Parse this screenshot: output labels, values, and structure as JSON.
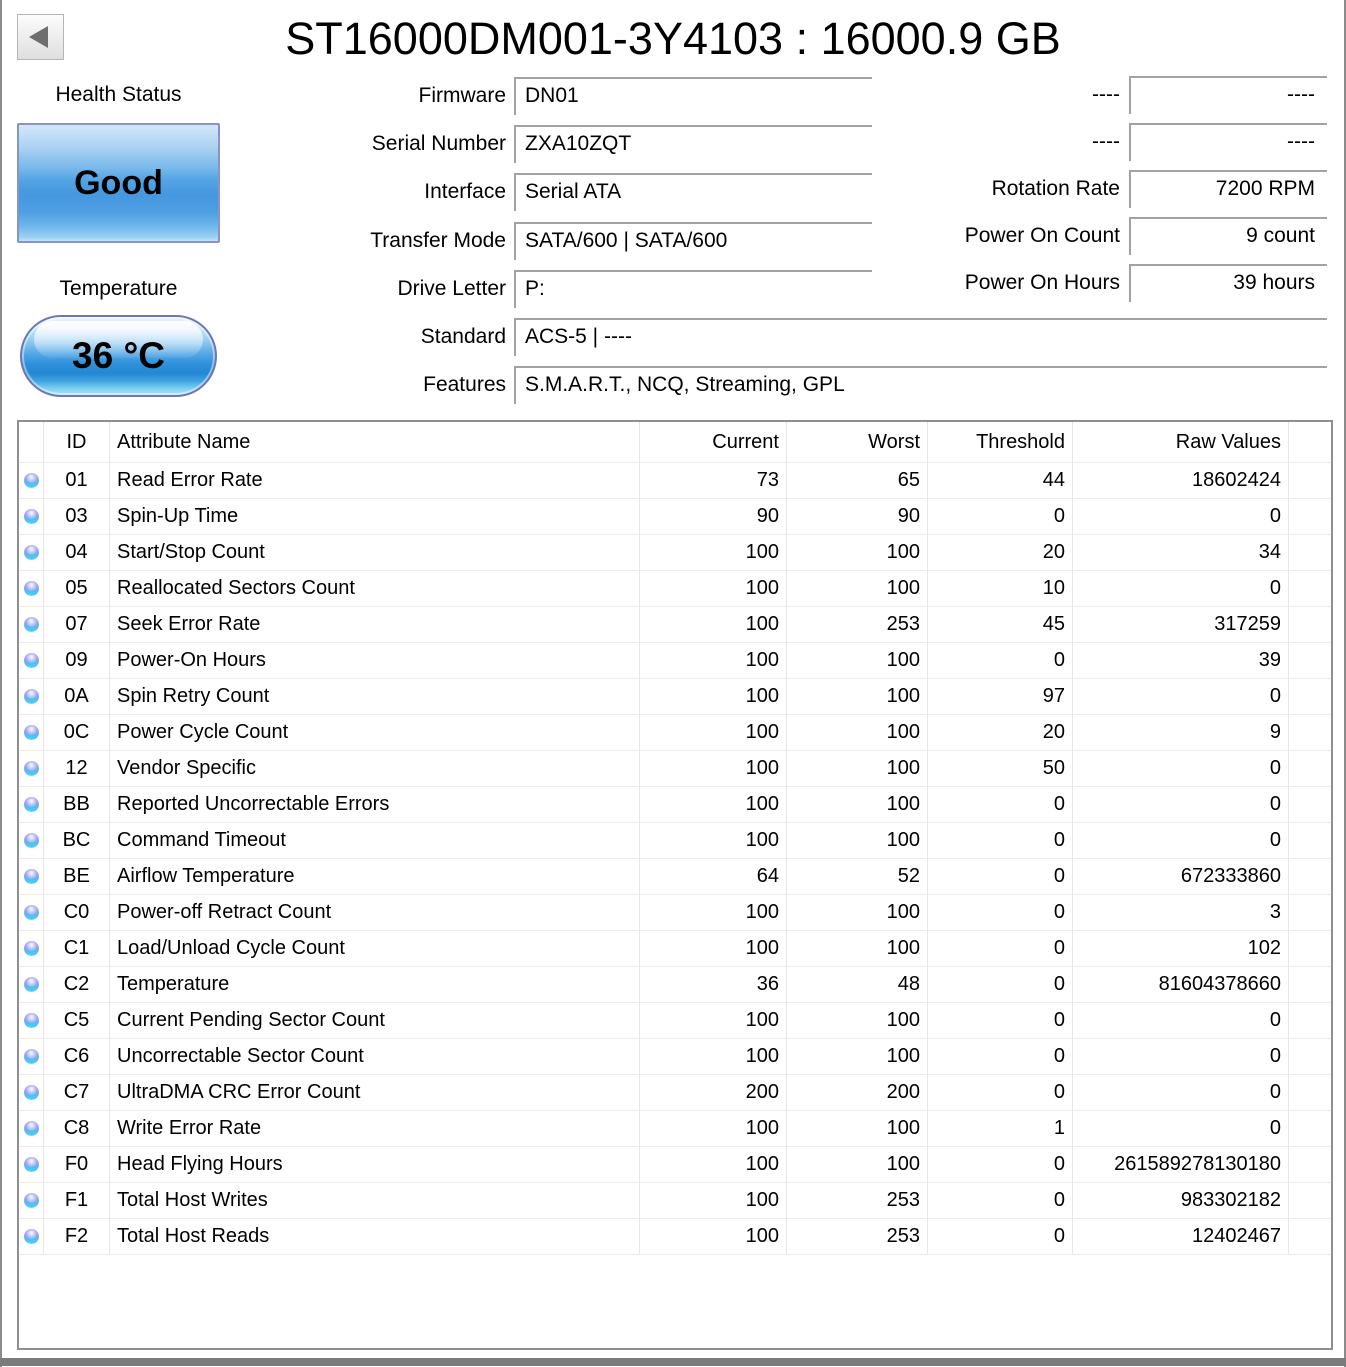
{
  "window": {
    "title": "ST16000DM001-3Y4103 : 16000.9 GB"
  },
  "health": {
    "label": "Health Status",
    "value": "Good",
    "color": "#58a7e6"
  },
  "temperature": {
    "label": "Temperature",
    "value": "36 °C",
    "color": "#2f91da"
  },
  "info_left": [
    {
      "label": "Firmware",
      "value": "DN01"
    },
    {
      "label": "Serial Number",
      "value": "ZXA10ZQT"
    },
    {
      "label": "Interface",
      "value": "Serial ATA"
    },
    {
      "label": "Transfer Mode",
      "value": "SATA/600 | SATA/600"
    },
    {
      "label": "Drive Letter",
      "value": "P:"
    }
  ],
  "info_wide": [
    {
      "label": "Standard",
      "value": "ACS-5 | ----"
    },
    {
      "label": "Features",
      "value": "S.M.A.R.T., NCQ, Streaming, GPL"
    }
  ],
  "info_right": [
    {
      "label": "----",
      "value": "----"
    },
    {
      "label": "----",
      "value": "----"
    },
    {
      "label": "Rotation Rate",
      "value": "7200 RPM"
    },
    {
      "label": "Power On Count",
      "value": "9 count"
    },
    {
      "label": "Power On Hours",
      "value": "39 hours"
    }
  ],
  "table": {
    "headers": [
      "ID",
      "Attribute Name",
      "Current",
      "Worst",
      "Threshold",
      "Raw Values"
    ],
    "status_icon": "blue-dot",
    "rows": [
      {
        "id": "01",
        "name": "Read Error Rate",
        "current": "73",
        "worst": "65",
        "threshold": "44",
        "raw": "18602424"
      },
      {
        "id": "03",
        "name": "Spin-Up Time",
        "current": "90",
        "worst": "90",
        "threshold": "0",
        "raw": "0"
      },
      {
        "id": "04",
        "name": "Start/Stop Count",
        "current": "100",
        "worst": "100",
        "threshold": "20",
        "raw": "34"
      },
      {
        "id": "05",
        "name": "Reallocated Sectors Count",
        "current": "100",
        "worst": "100",
        "threshold": "10",
        "raw": "0"
      },
      {
        "id": "07",
        "name": "Seek Error Rate",
        "current": "100",
        "worst": "253",
        "threshold": "45",
        "raw": "317259"
      },
      {
        "id": "09",
        "name": "Power-On Hours",
        "current": "100",
        "worst": "100",
        "threshold": "0",
        "raw": "39"
      },
      {
        "id": "0A",
        "name": "Spin Retry Count",
        "current": "100",
        "worst": "100",
        "threshold": "97",
        "raw": "0"
      },
      {
        "id": "0C",
        "name": "Power Cycle Count",
        "current": "100",
        "worst": "100",
        "threshold": "20",
        "raw": "9"
      },
      {
        "id": "12",
        "name": "Vendor Specific",
        "current": "100",
        "worst": "100",
        "threshold": "50",
        "raw": "0"
      },
      {
        "id": "BB",
        "name": "Reported Uncorrectable Errors",
        "current": "100",
        "worst": "100",
        "threshold": "0",
        "raw": "0"
      },
      {
        "id": "BC",
        "name": "Command Timeout",
        "current": "100",
        "worst": "100",
        "threshold": "0",
        "raw": "0"
      },
      {
        "id": "BE",
        "name": "Airflow Temperature",
        "current": "64",
        "worst": "52",
        "threshold": "0",
        "raw": "672333860"
      },
      {
        "id": "C0",
        "name": "Power-off Retract Count",
        "current": "100",
        "worst": "100",
        "threshold": "0",
        "raw": "3"
      },
      {
        "id": "C1",
        "name": "Load/Unload Cycle Count",
        "current": "100",
        "worst": "100",
        "threshold": "0",
        "raw": "102"
      },
      {
        "id": "C2",
        "name": "Temperature",
        "current": "36",
        "worst": "48",
        "threshold": "0",
        "raw": "81604378660"
      },
      {
        "id": "C5",
        "name": "Current Pending Sector Count",
        "current": "100",
        "worst": "100",
        "threshold": "0",
        "raw": "0"
      },
      {
        "id": "C6",
        "name": "Uncorrectable Sector Count",
        "current": "100",
        "worst": "100",
        "threshold": "0",
        "raw": "0"
      },
      {
        "id": "C7",
        "name": "UltraDMA CRC Error Count",
        "current": "200",
        "worst": "200",
        "threshold": "0",
        "raw": "0"
      },
      {
        "id": "C8",
        "name": "Write Error Rate",
        "current": "100",
        "worst": "100",
        "threshold": "1",
        "raw": "0"
      },
      {
        "id": "F0",
        "name": "Head Flying Hours",
        "current": "100",
        "worst": "100",
        "threshold": "0",
        "raw": "261589278130180"
      },
      {
        "id": "F1",
        "name": "Total Host Writes",
        "current": "100",
        "worst": "253",
        "threshold": "0",
        "raw": "983302182"
      },
      {
        "id": "F2",
        "name": "Total Host Reads",
        "current": "100",
        "worst": "253",
        "threshold": "0",
        "raw": "12402467"
      }
    ]
  }
}
